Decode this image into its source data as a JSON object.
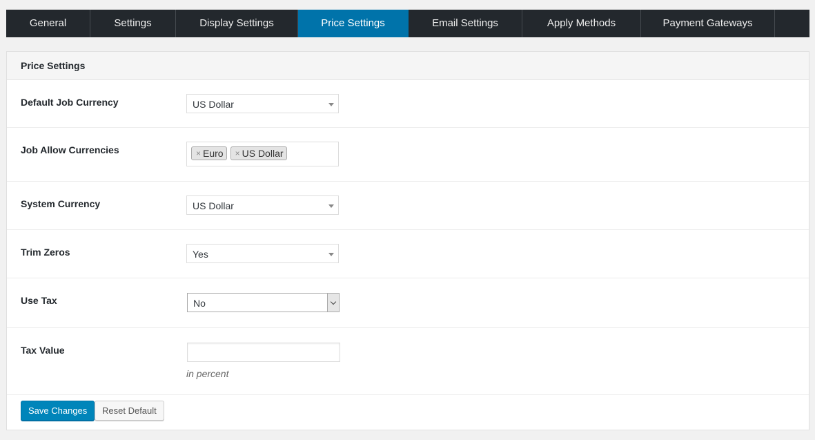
{
  "tabs": [
    {
      "label": "General",
      "active": false
    },
    {
      "label": "Settings",
      "active": false
    },
    {
      "label": "Display Settings",
      "active": false
    },
    {
      "label": "Price Settings",
      "active": true
    },
    {
      "label": "Email Settings",
      "active": false
    },
    {
      "label": "Apply Methods",
      "active": false
    },
    {
      "label": "Payment Gateways",
      "active": false
    }
  ],
  "panel": {
    "title": "Price Settings"
  },
  "fields": {
    "default_currency": {
      "label": "Default Job Currency",
      "value": "US Dollar"
    },
    "allow_currencies": {
      "label": "Job Allow Currencies",
      "chips": [
        "Euro",
        "US Dollar"
      ]
    },
    "system_currency": {
      "label": "System Currency",
      "value": "US Dollar"
    },
    "trim_zeros": {
      "label": "Trim Zeros",
      "value": "Yes"
    },
    "use_tax": {
      "label": "Use Tax",
      "value": "No"
    },
    "tax_value": {
      "label": "Tax Value",
      "value": "",
      "hint": "in percent"
    }
  },
  "buttons": {
    "save": "Save Changes",
    "reset": "Reset Default"
  },
  "icons": {
    "chip_remove": "×"
  },
  "colors": {
    "tab_bar": "#23282d",
    "active_tab": "#0073aa",
    "primary_button": "#0085ba"
  }
}
